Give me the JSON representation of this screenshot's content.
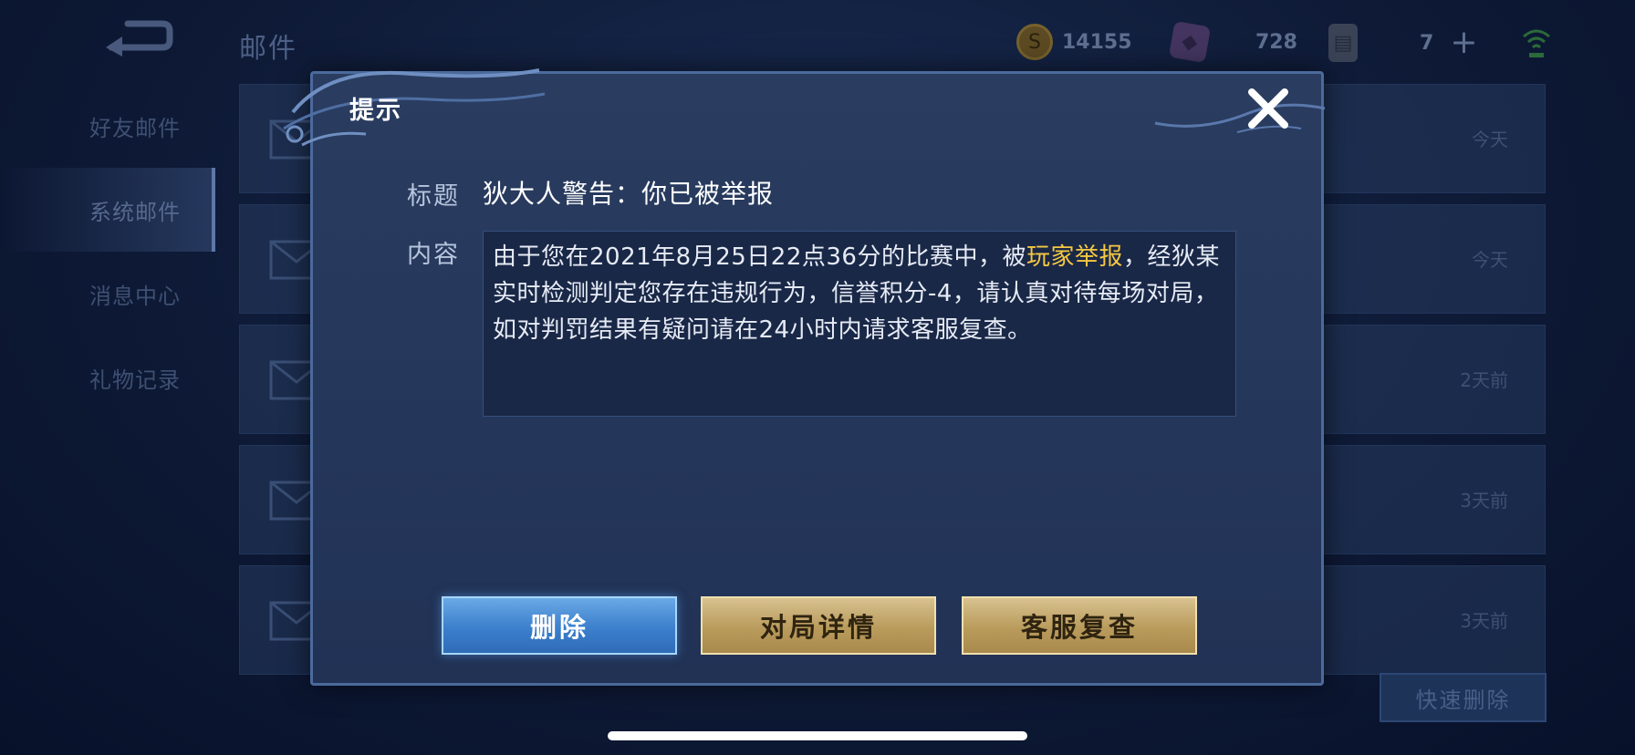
{
  "top_bar": {
    "title": "邮件",
    "gold": "14155",
    "gems": "728",
    "cards": "7",
    "plus": "+"
  },
  "sidebar": {
    "items": [
      {
        "label": "好友邮件"
      },
      {
        "label": "系统邮件"
      },
      {
        "label": "消息中心"
      },
      {
        "label": "礼物记录"
      }
    ]
  },
  "mail_list": {
    "dates": [
      "今天",
      "今天",
      "2天前",
      "3天前",
      "3天前"
    ]
  },
  "quick_delete": "快速删除",
  "modal": {
    "title": "提示",
    "subject_label": "标题",
    "subject": "狄大人警告：你已被举报",
    "content_label": "内容",
    "content_part1": "由于您在2021年8月25日22点36分的比赛中，被",
    "content_highlight": "玩家举报",
    "content_part2": "，经狄某实时检测判定您存在违规行为，信誉积分-4，请认真对待每场对局，如对判罚结果有疑问请在24小时内请求客服复查。",
    "buttons": {
      "delete": "删除",
      "match_details": "对局详情",
      "support_review": "客服复查"
    }
  }
}
